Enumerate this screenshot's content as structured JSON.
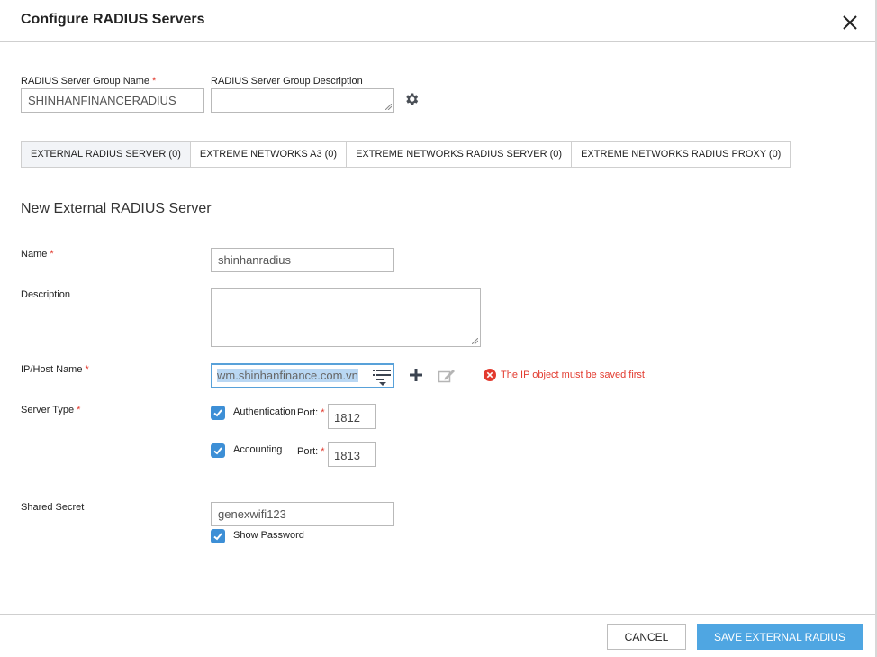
{
  "dialog": {
    "title": "Configure RADIUS Servers",
    "close_icon": "close-icon"
  },
  "group": {
    "name_label": "RADIUS Server Group Name",
    "name_value": "SHINHANFINANCERADIUS",
    "description_label": "RADIUS Server Group Description",
    "description_value": "",
    "settings_icon": "gear-icon"
  },
  "tabs": [
    {
      "label": "EXTERNAL RADIUS SERVER  (0)",
      "active": true
    },
    {
      "label": "EXTREME NETWORKS A3  (0)",
      "active": false
    },
    {
      "label": "EXTREME NETWORKS RADIUS SERVER  (0)",
      "active": false
    },
    {
      "label": "EXTREME NETWORKS RADIUS PROXY  (0)",
      "active": false
    }
  ],
  "form": {
    "section_title": "New External RADIUS Server",
    "required_marker": "*",
    "name_label": "Name",
    "name_value": "shinhanradius",
    "description_label": "Description",
    "description_value": "",
    "ip_label": "IP/Host Name",
    "ip_value": "wm.shinhanfinance.com.vn",
    "ip_error": "The IP object must be saved first.",
    "server_type_label": "Server Type",
    "authentication_label": "Authentication",
    "authentication_checked": true,
    "auth_port_label": "Port:",
    "auth_port_value": "1812",
    "accounting_label": "Accounting",
    "accounting_checked": true,
    "acct_port_label": "Port:",
    "acct_port_value": "1813",
    "shared_secret_label": "Shared Secret",
    "shared_secret_value": "genexwifi123",
    "show_password_label": "Show Password",
    "show_password_checked": true
  },
  "footer": {
    "cancel_label": "CANCEL",
    "save_label": "SAVE EXTERNAL RADIUS"
  },
  "colors": {
    "accent": "#4fa6e2",
    "checkbox": "#3d8fd6",
    "error": "#e23a2e",
    "focus_border": "#58a1d9",
    "active_tab_bg": "#f2f4f7"
  }
}
